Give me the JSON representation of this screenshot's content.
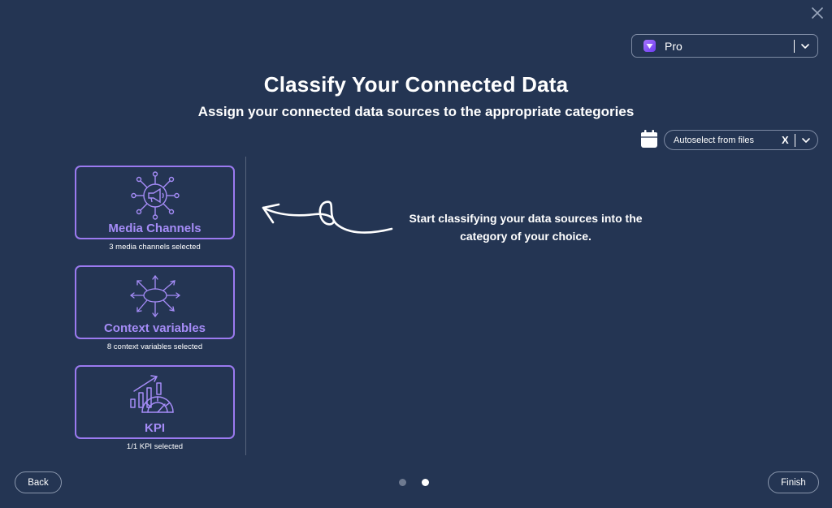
{
  "header": {
    "plan": {
      "label": "Pro",
      "icon": "pro-plan-icon"
    },
    "close_icon": "close-icon"
  },
  "main": {
    "title": "Classify Your Connected Data",
    "subtitle": "Assign your connected data sources to the appropriate categories",
    "autoselect": {
      "label": "Autoselect from files",
      "clear": "X",
      "icon": "calendar-icon"
    },
    "hint": "Start classifying your data sources into the category of your choice."
  },
  "categories": [
    {
      "name": "media-channels",
      "label": "Media Channels",
      "caption": "3 media channels selected",
      "icon": "megaphone-network-icon"
    },
    {
      "name": "context-variables",
      "label": "Context variables",
      "caption": "8 context variables selected",
      "icon": "radiating-arrows-icon"
    },
    {
      "name": "kpi",
      "label": "KPI",
      "caption": "1/1 KPI selected",
      "icon": "chart-gauge-icon"
    }
  ],
  "footer": {
    "back_label": "Back",
    "finish_label": "Finish",
    "pagination": {
      "current": 2,
      "total": 2
    }
  },
  "colors": {
    "background": "#243553",
    "accent": "#9b7af0",
    "accent_text": "#a58cf7",
    "border": "#7d8aa3"
  }
}
